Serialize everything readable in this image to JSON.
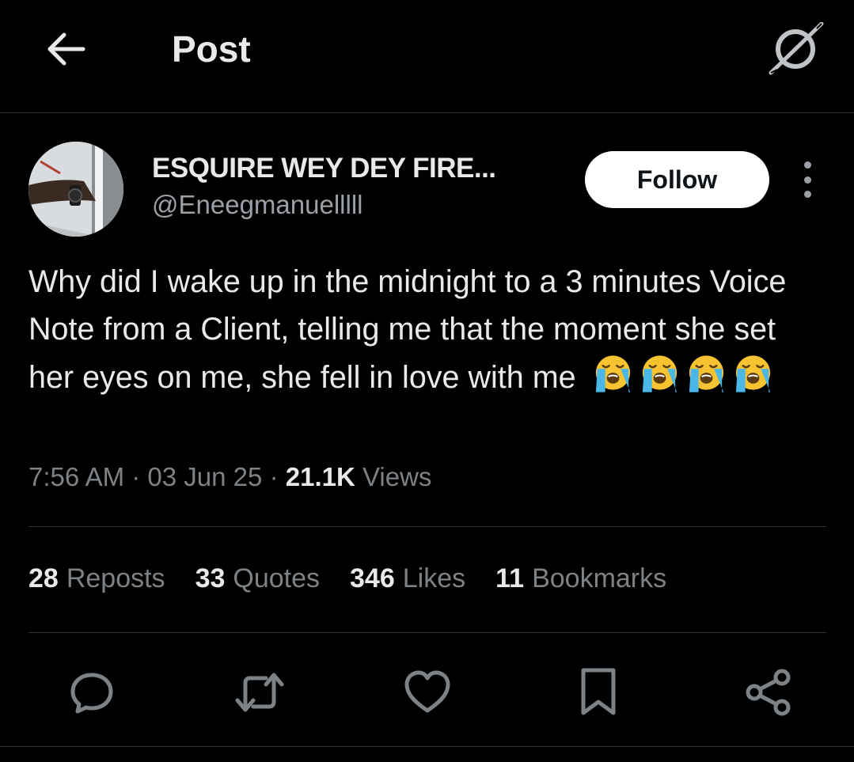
{
  "header": {
    "back_icon": "arrow-left-icon",
    "title": "Post",
    "grok_icon": "grok-icon"
  },
  "author": {
    "display_name": "ESQUIRE WEY DEY FIRE...",
    "handle": "@Eneegmanuelllll",
    "follow_label": "Follow",
    "more_icon": "more-vertical-icon"
  },
  "post": {
    "text": "Why did I wake up in the midnight to a 3 minutes Voice Note from a Client, telling me that the moment she set her eyes on me, she fell in love with me",
    "emoji": [
      "loudly-crying-face",
      "loudly-crying-face",
      "loudly-crying-face",
      "loudly-crying-face"
    ],
    "time": "7:56 AM",
    "date": "03 Jun 25",
    "views_count": "21.1K",
    "views_label": "Views",
    "separator": "·"
  },
  "stats": [
    {
      "count": "28",
      "label": "Reposts"
    },
    {
      "count": "33",
      "label": "Quotes"
    },
    {
      "count": "346",
      "label": "Likes"
    },
    {
      "count": "11",
      "label": "Bookmarks"
    }
  ],
  "actions": [
    {
      "name": "reply",
      "icon": "reply-icon"
    },
    {
      "name": "repost",
      "icon": "repost-icon"
    },
    {
      "name": "like",
      "icon": "heart-icon"
    },
    {
      "name": "bookmark",
      "icon": "bookmark-icon"
    },
    {
      "name": "share",
      "icon": "share-icon"
    }
  ],
  "colors": {
    "background": "#000000",
    "text_primary": "#e7e9ea",
    "text_secondary": "#7d8287",
    "divider": "#2f3336",
    "follow_bg": "#ffffff",
    "emoji_yellow": "#f7c331",
    "emoji_tears": "#4ab7e8"
  }
}
